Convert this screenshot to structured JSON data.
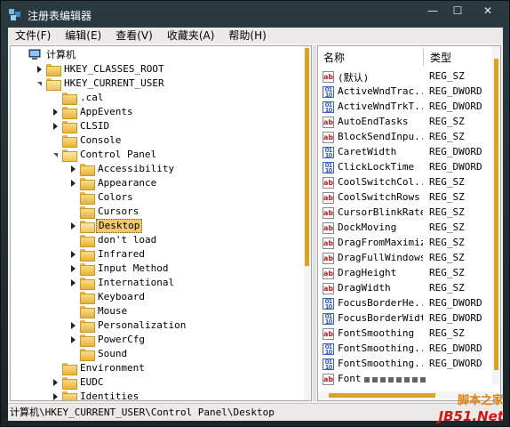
{
  "window": {
    "title": "注册表编辑器",
    "minimize_glyph": "—",
    "maximize_glyph": "☐",
    "close_glyph": "✕"
  },
  "menu": [
    "文件(F)",
    "编辑(E)",
    "查看(V)",
    "收藏夹(A)",
    "帮助(H)"
  ],
  "tree": [
    {
      "label": "计算机",
      "level": 0,
      "icon": "computer-icon",
      "expanded": true
    },
    {
      "label": "HKEY_CLASSES_ROOT",
      "level": 1,
      "expander": "closed"
    },
    {
      "label": "HKEY_CURRENT_USER",
      "level": 1,
      "expander": "open"
    },
    {
      "label": ".cal",
      "level": 2,
      "expander": "none"
    },
    {
      "label": "AppEvents",
      "level": 2,
      "expander": "closed"
    },
    {
      "label": "CLSID",
      "level": 2,
      "expander": "closed"
    },
    {
      "label": "Console",
      "level": 2,
      "expander": "none"
    },
    {
      "label": "Control Panel",
      "level": 2,
      "expander": "open"
    },
    {
      "label": "Accessibility",
      "level": 3,
      "expander": "closed"
    },
    {
      "label": "Appearance",
      "level": 3,
      "expander": "closed"
    },
    {
      "label": "Colors",
      "level": 3,
      "expander": "none"
    },
    {
      "label": "Cursors",
      "level": 3,
      "expander": "none"
    },
    {
      "label": "Desktop",
      "level": 3,
      "expander": "closed",
      "selected": true
    },
    {
      "label": "don't load",
      "level": 3,
      "expander": "none"
    },
    {
      "label": "Infrared",
      "level": 3,
      "expander": "closed"
    },
    {
      "label": "Input Method",
      "level": 3,
      "expander": "closed"
    },
    {
      "label": "International",
      "level": 3,
      "expander": "closed"
    },
    {
      "label": "Keyboard",
      "level": 3,
      "expander": "none"
    },
    {
      "label": "Mouse",
      "level": 3,
      "expander": "none"
    },
    {
      "label": "Personalization",
      "level": 3,
      "expander": "closed"
    },
    {
      "label": "PowerCfg",
      "level": 3,
      "expander": "closed"
    },
    {
      "label": "Sound",
      "level": 3,
      "expander": "none"
    },
    {
      "label": "Environment",
      "level": 2,
      "expander": "none"
    },
    {
      "label": "EUDC",
      "level": 2,
      "expander": "closed"
    },
    {
      "label": "Identities",
      "level": 2,
      "expander": "closed"
    }
  ],
  "list": {
    "columns": {
      "name": "名称",
      "type": "类型"
    },
    "rows": [
      {
        "name": "(默认)",
        "type": "REG_SZ",
        "kind": "sz"
      },
      {
        "name": "ActiveWndTrac...",
        "type": "REG_DWORD",
        "kind": "dword"
      },
      {
        "name": "ActiveWndTrkT...",
        "type": "REG_DWORD",
        "kind": "dword"
      },
      {
        "name": "AutoEndTasks",
        "type": "REG_SZ",
        "kind": "sz"
      },
      {
        "name": "BlockSendInpu...",
        "type": "REG_SZ",
        "kind": "sz"
      },
      {
        "name": "CaretWidth",
        "type": "REG_DWORD",
        "kind": "dword"
      },
      {
        "name": "ClickLockTime",
        "type": "REG_DWORD",
        "kind": "dword"
      },
      {
        "name": "CoolSwitchCol...",
        "type": "REG_SZ",
        "kind": "sz"
      },
      {
        "name": "CoolSwitchRows",
        "type": "REG_SZ",
        "kind": "sz"
      },
      {
        "name": "CursorBlinkRate",
        "type": "REG_SZ",
        "kind": "sz"
      },
      {
        "name": "DockMoving",
        "type": "REG_SZ",
        "kind": "sz"
      },
      {
        "name": "DragFromMaximize",
        "type": "REG_SZ",
        "kind": "sz"
      },
      {
        "name": "DragFullWindows",
        "type": "REG_SZ",
        "kind": "sz"
      },
      {
        "name": "DragHeight",
        "type": "REG_SZ",
        "kind": "sz"
      },
      {
        "name": "DragWidth",
        "type": "REG_SZ",
        "kind": "sz"
      },
      {
        "name": "FocusBorderHe...",
        "type": "REG_DWORD",
        "kind": "dword"
      },
      {
        "name": "FocusBorderWidth",
        "type": "REG_DWORD",
        "kind": "dword"
      },
      {
        "name": "FontSmoothing",
        "type": "REG_SZ",
        "kind": "sz"
      },
      {
        "name": "FontSmoothing...",
        "type": "REG_DWORD",
        "kind": "dword"
      },
      {
        "name": "FontSmoothing...",
        "type": "REG_DWORD",
        "kind": "dword"
      },
      {
        "name": "Font",
        "type": "",
        "kind": "sz"
      }
    ]
  },
  "status": {
    "path": "计算机\\HKEY_CURRENT_USER\\Control Panel\\Desktop"
  },
  "watermark": {
    "line1": "脚本之家",
    "line2": "JB51.Net"
  },
  "colors": {
    "accent": "#d9a520",
    "selection": "#f1c86a",
    "titlebar": "#26343a"
  }
}
